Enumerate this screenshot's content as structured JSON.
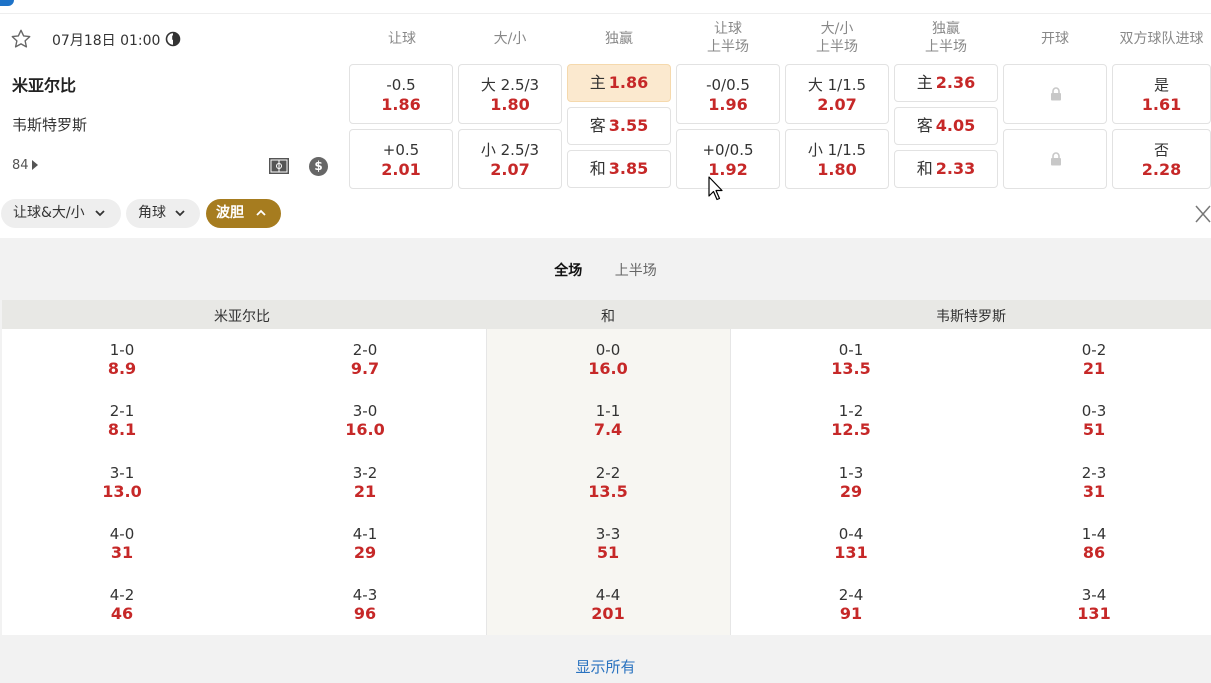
{
  "header": {
    "datetime": "07月18日 01:00",
    "columns": [
      "让球",
      "大/小",
      "独赢",
      "让球\n上半场",
      "大/小\n上半场",
      "独赢\n上半场",
      "开球",
      "双方球队进球"
    ]
  },
  "match": {
    "home": "米亚尔比",
    "away": "韦斯特罗斯",
    "minute": "84"
  },
  "odds": {
    "handicap": [
      {
        "line": "-0.5",
        "val": "1.86"
      },
      {
        "line": "+0.5",
        "val": "2.01"
      }
    ],
    "total": [
      {
        "line": "大 2.5/3",
        "val": "1.80"
      },
      {
        "line": "小 2.5/3",
        "val": "2.07"
      }
    ],
    "moneyline": [
      {
        "lbl": "主",
        "val": "1.86"
      },
      {
        "lbl": "客",
        "val": "3.55"
      },
      {
        "lbl": "和",
        "val": "3.85"
      }
    ],
    "handicap_1h": [
      {
        "line": "-0/0.5",
        "val": "1.96"
      },
      {
        "line": "+0/0.5",
        "val": "1.92"
      }
    ],
    "total_1h": [
      {
        "line": "大 1/1.5",
        "val": "2.07"
      },
      {
        "line": "小 1/1.5",
        "val": "1.80"
      }
    ],
    "moneyline_1h": [
      {
        "lbl": "主",
        "val": "2.36"
      },
      {
        "lbl": "客",
        "val": "4.05"
      },
      {
        "lbl": "和",
        "val": "2.33"
      }
    ],
    "btts": [
      {
        "line": "是",
        "val": "1.61"
      },
      {
        "line": "否",
        "val": "2.28"
      }
    ]
  },
  "chips": [
    "让球&大/小",
    "角球",
    "波胆"
  ],
  "panel": {
    "tabs": [
      "全场",
      "上半场"
    ],
    "heads": [
      "米亚尔比",
      "和",
      "韦斯特罗斯"
    ],
    "rows": [
      [
        [
          "1-0",
          "8.9"
        ],
        [
          "2-0",
          "9.7"
        ],
        [
          "0-0",
          "16.0"
        ],
        [
          "0-1",
          "13.5"
        ],
        [
          "0-2",
          "21"
        ]
      ],
      [
        [
          "2-1",
          "8.1"
        ],
        [
          "3-0",
          "16.0"
        ],
        [
          "1-1",
          "7.4"
        ],
        [
          "1-2",
          "12.5"
        ],
        [
          "0-3",
          "51"
        ]
      ],
      [
        [
          "3-1",
          "13.0"
        ],
        [
          "3-2",
          "21"
        ],
        [
          "2-2",
          "13.5"
        ],
        [
          "1-3",
          "29"
        ],
        [
          "2-3",
          "31"
        ]
      ],
      [
        [
          "4-0",
          "31"
        ],
        [
          "4-1",
          "29"
        ],
        [
          "3-3",
          "51"
        ],
        [
          "0-4",
          "131"
        ],
        [
          "1-4",
          "86"
        ]
      ],
      [
        [
          "4-2",
          "46"
        ],
        [
          "4-3",
          "96"
        ],
        [
          "4-4",
          "201"
        ],
        [
          "2-4",
          "91"
        ],
        [
          "3-4",
          "131"
        ]
      ]
    ],
    "show_all": "显示所有"
  },
  "colors": {
    "odds_red": "#c62828",
    "active_chip": "#a67c1f",
    "selected_odd": "#fbe9cf",
    "link": "#2a73c0"
  }
}
